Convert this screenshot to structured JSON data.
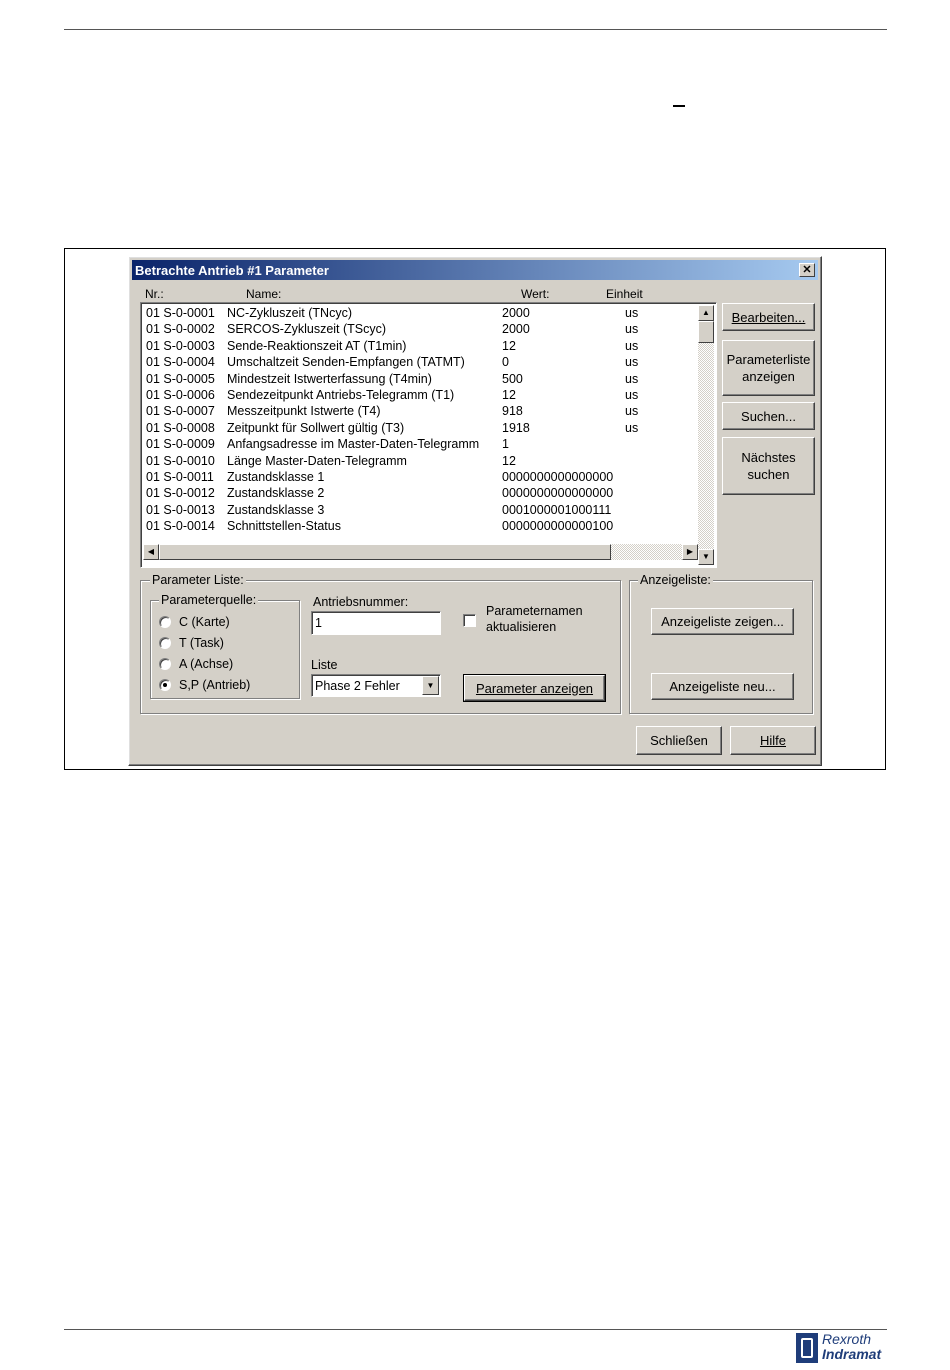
{
  "dialog": {
    "title": "Betrachte Antrieb #1 Parameter",
    "close_glyph": "✕"
  },
  "list": {
    "headers": {
      "nr": "Nr.:",
      "name": "Name:",
      "value": "Wert:",
      "unit": "Einheit"
    },
    "rows": [
      {
        "nr": "01 S-0-0001",
        "name": "NC-Zykluszeit (TNcyc)",
        "value": "2000",
        "unit": "us"
      },
      {
        "nr": "01 S-0-0002",
        "name": "SERCOS-Zykluszeit (TScyc)",
        "value": "2000",
        "unit": "us"
      },
      {
        "nr": "01 S-0-0003",
        "name": "Sende-Reaktionszeit AT (T1min)",
        "value": "12",
        "unit": "us"
      },
      {
        "nr": "01 S-0-0004",
        "name": "Umschaltzeit Senden-Empfangen (TATMT)",
        "value": "0",
        "unit": "us"
      },
      {
        "nr": "01 S-0-0005",
        "name": "Mindestzeit Istwerterfassung (T4min)",
        "value": "500",
        "unit": "us"
      },
      {
        "nr": "01 S-0-0006",
        "name": "Sendezeitpunkt Antriebs-Telegramm (T1)",
        "value": "12",
        "unit": "us"
      },
      {
        "nr": "01 S-0-0007",
        "name": "Messzeitpunkt Istwerte (T4)",
        "value": "918",
        "unit": "us"
      },
      {
        "nr": "01 S-0-0008",
        "name": "Zeitpunkt für Sollwert gültig (T3)",
        "value": "1918",
        "unit": "us"
      },
      {
        "nr": "01 S-0-0009",
        "name": "Anfangsadresse im Master-Daten-Telegramm",
        "value": "1",
        "unit": ""
      },
      {
        "nr": "01 S-0-0010",
        "name": "Länge Master-Daten-Telegramm",
        "value": "12",
        "unit": ""
      },
      {
        "nr": "01 S-0-0011",
        "name": "Zustandsklasse 1",
        "value": "0000000000000000",
        "unit": ""
      },
      {
        "nr": "01 S-0-0012",
        "name": "Zustandsklasse 2",
        "value": "0000000000000000",
        "unit": ""
      },
      {
        "nr": "01 S-0-0013",
        "name": "Zustandsklasse 3",
        "value": "0001000001000111",
        "unit": ""
      },
      {
        "nr": "01 S-0-0014",
        "name": "Schnittstellen-Status",
        "value": "0000000000000100",
        "unit": ""
      }
    ]
  },
  "side_buttons": {
    "edit": "Bearbeiten...",
    "show_list_line1": "Parameterliste",
    "show_list_line2": "anzeigen",
    "search": "Suchen...",
    "next_line1": "Nächstes",
    "next_line2": "suchen"
  },
  "param_list": {
    "group_label": "Parameter Liste:",
    "source_group_label": "Parameterquelle:",
    "sources": [
      {
        "label": "C (Karte)",
        "selected": false
      },
      {
        "label": "T (Task)",
        "selected": false
      },
      {
        "label": "A (Achse)",
        "selected": false
      },
      {
        "label": "S,P (Antrieb)",
        "selected": true
      }
    ],
    "drive_number_label": "Antriebsnummer:",
    "drive_number_value": "1",
    "update_names_line1": "Parameternamen",
    "update_names_line2": "aktualisieren",
    "list_label": "Liste",
    "list_selected": "Phase 2 Fehler",
    "show_params_button": "Parameter anzeigen"
  },
  "display_list": {
    "group_label": "Anzeigeliste:",
    "show_button": "Anzeigeliste zeigen...",
    "new_button": "Anzeigeliste neu..."
  },
  "footer_buttons": {
    "close": "Schließen",
    "help": "Hilfe"
  },
  "logo": {
    "line1": "Rexroth",
    "line2": "Indramat"
  }
}
